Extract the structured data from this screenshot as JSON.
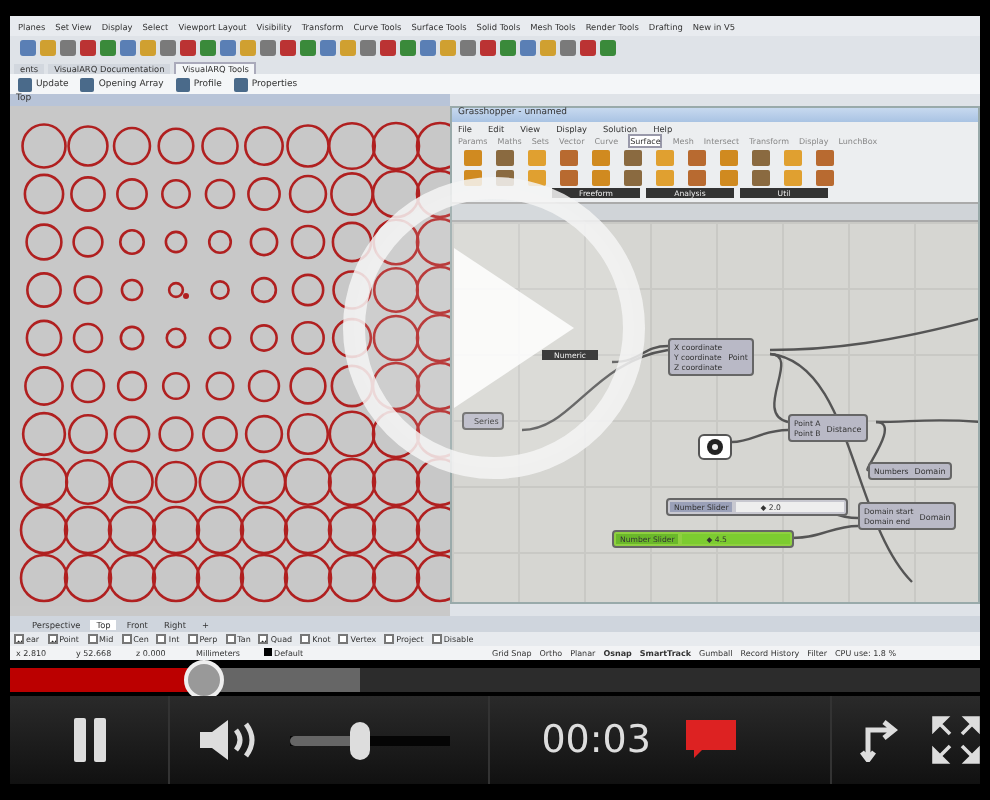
{
  "rhino": {
    "menu_tabs": [
      "Planes",
      "Set View",
      "Display",
      "Select",
      "Viewport Layout",
      "Visibility",
      "Transform",
      "Curve Tools",
      "Surface Tools",
      "Solid Tools",
      "Mesh Tools",
      "Render Tools",
      "Drafting",
      "New in V5"
    ],
    "panel_tabs": [
      {
        "label": "ents",
        "selected": false
      },
      {
        "label": "VisualARQ Documentation",
        "selected": false
      },
      {
        "label": "VisualARQ Tools",
        "selected": true
      }
    ],
    "commands": [
      "Update",
      "Opening Array",
      "Profile",
      "Properties"
    ],
    "viewport": {
      "title": "Top"
    },
    "viewport_tabs": [
      {
        "label": "Perspective",
        "selected": false
      },
      {
        "label": "Top",
        "selected": true
      },
      {
        "label": "Front",
        "selected": false
      },
      {
        "label": "Right",
        "selected": false
      },
      {
        "label": "+",
        "selected": false
      }
    ],
    "osnaps": [
      {
        "label": "ear",
        "checked": true
      },
      {
        "label": "Point",
        "checked": true
      },
      {
        "label": "Mid",
        "checked": false
      },
      {
        "label": "Cen",
        "checked": false
      },
      {
        "label": "Int",
        "checked": false
      },
      {
        "label": "Perp",
        "checked": false
      },
      {
        "label": "Tan",
        "checked": false
      },
      {
        "label": "Quad",
        "checked": true
      },
      {
        "label": "Knot",
        "checked": false
      },
      {
        "label": "Vertex",
        "checked": false
      },
      {
        "label": "Project",
        "checked": false
      },
      {
        "label": "Disable",
        "checked": false
      }
    ],
    "coordinates": [
      "x 2.810",
      "y 52.668",
      "z 0.000"
    ],
    "units": "Millimeters",
    "layer": "Default",
    "status_toggles": [
      {
        "label": "Grid Snap",
        "on": false
      },
      {
        "label": "Ortho",
        "on": false
      },
      {
        "label": "Planar",
        "on": false
      },
      {
        "label": "Osnap",
        "on": true
      },
      {
        "label": "SmartTrack",
        "on": true
      },
      {
        "label": "Gumball",
        "on": false
      },
      {
        "label": "Record History",
        "on": false
      },
      {
        "label": "Filter",
        "on": false
      }
    ],
    "cpu": "CPU use: 1.8 %"
  },
  "grasshopper": {
    "title": "Grasshopper - unnamed",
    "menu": [
      "File",
      "Edit",
      "View",
      "Display",
      "Solution",
      "Help"
    ],
    "tabs": [
      {
        "label": "Params",
        "selected": false
      },
      {
        "label": "Maths",
        "selected": false
      },
      {
        "label": "Sets",
        "selected": false
      },
      {
        "label": "Vector",
        "selected": false
      },
      {
        "label": "Curve",
        "selected": false
      },
      {
        "label": "Surface",
        "selected": true
      },
      {
        "label": "Mesh",
        "selected": false
      },
      {
        "label": "Intersect",
        "selected": false
      },
      {
        "label": "Transform",
        "selected": false
      },
      {
        "label": "Display",
        "selected": false
      },
      {
        "label": "LunchBox",
        "selected": false
      }
    ],
    "groups": [
      "Freeform",
      "Analysis",
      "Util"
    ],
    "nodes": [
      {
        "kind": "component",
        "inputs": [
          "X coordinate",
          "Y coordinate",
          "Z coordinate"
        ],
        "name": "Point"
      },
      {
        "kind": "component",
        "inputs": [
          "Point A",
          "Point B"
        ],
        "name": "Distance"
      },
      {
        "kind": "component",
        "inputs": [
          "Numbers"
        ],
        "name": "Domain"
      },
      {
        "kind": "component",
        "inputs": [
          "Domain start",
          "Domain end"
        ],
        "name": "Domain"
      },
      {
        "kind": "component",
        "name": "Series"
      },
      {
        "kind": "label",
        "name": "Numeric"
      },
      {
        "kind": "param"
      },
      {
        "kind": "slider",
        "name": "Number Slider",
        "value": "◆ 2.0",
        "active": false
      },
      {
        "kind": "slider",
        "name": "Number Slider",
        "value": "◆ 4.5",
        "active": true
      }
    ]
  },
  "player": {
    "progress": {
      "level": 0.2
    },
    "buffer": {
      "level": 0.36
    },
    "playing": true,
    "volume": {
      "level": 0.43
    },
    "time": "00:03"
  }
}
